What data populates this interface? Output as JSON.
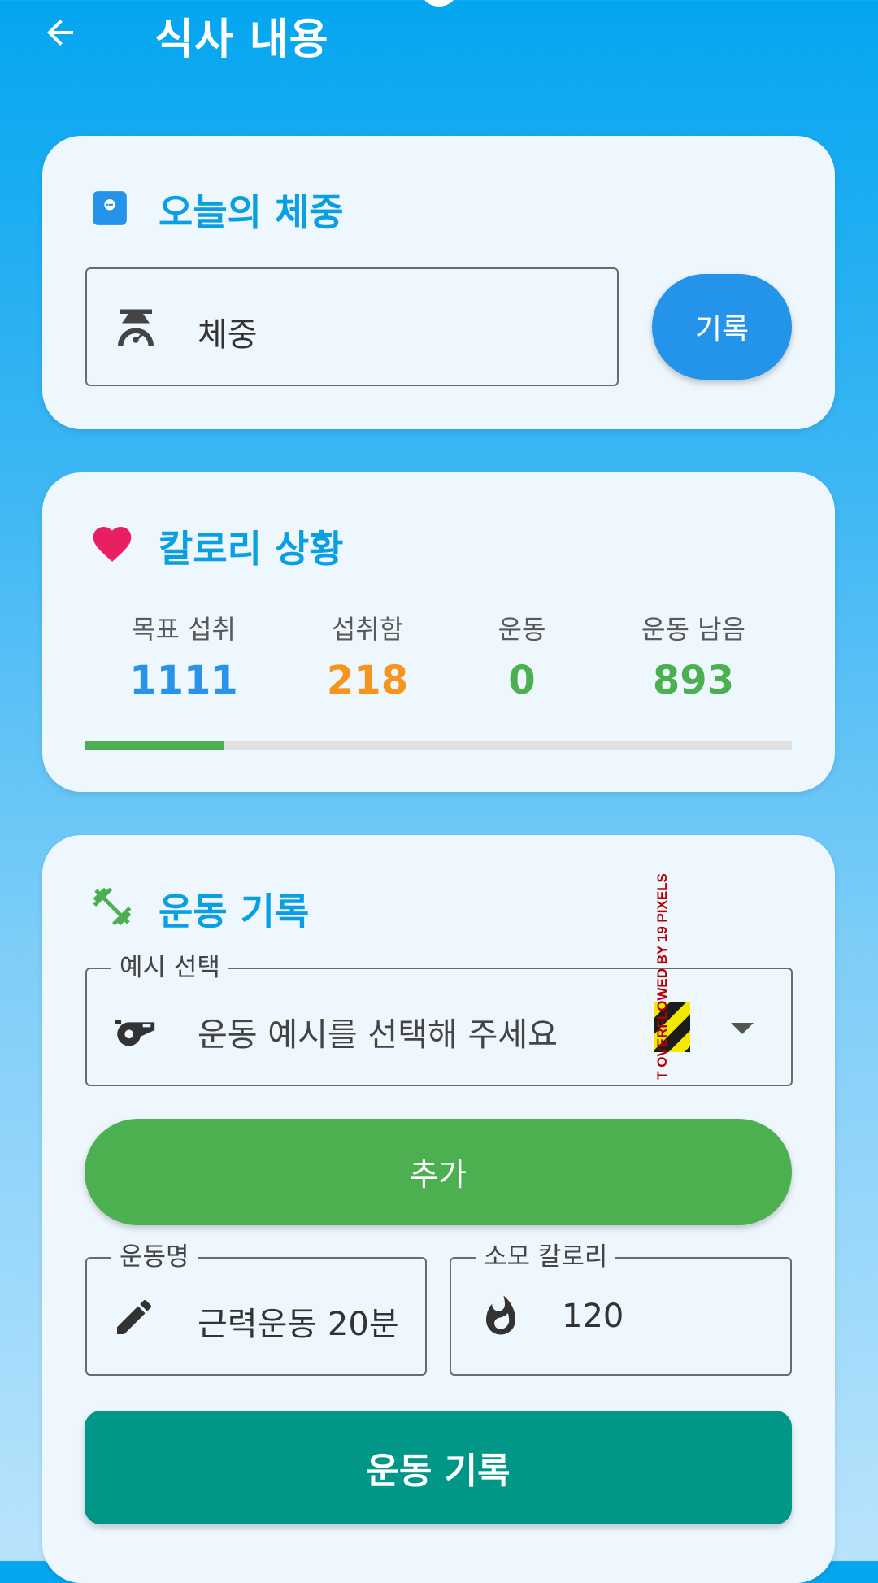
{
  "header": {
    "title": "식사 내용",
    "back_icon": "arrow-left-icon"
  },
  "weight_card": {
    "title": "오늘의 체중",
    "title_icon": "chat-bubble-icon",
    "input_placeholder": "체중",
    "input_icon": "scale-icon",
    "record_button": "기록"
  },
  "calorie_card": {
    "title": "칼로리 상황",
    "title_icon": "heart-icon",
    "stats": [
      {
        "label": "목표 섭취",
        "value": "1111",
        "color": "#2893e8"
      },
      {
        "label": "섭취함",
        "value": "218",
        "color": "#f7941d"
      },
      {
        "label": "운동",
        "value": "0",
        "color": "#4caf50"
      },
      {
        "label": "운동 남음",
        "value": "893",
        "color": "#4caf50"
      }
    ],
    "progress_fraction": 0.196
  },
  "exercise_card": {
    "title": "운동 기록",
    "title_icon": "dumbbell-icon",
    "example_select": {
      "legend": "예시 선택",
      "placeholder": "운동 예시를 선택해 주세요",
      "icon": "whistle-icon"
    },
    "overflow_warning": "T OVERFLOWED BY 19 PIXELS",
    "add_button": "추가",
    "name_field": {
      "legend": "운동명",
      "value": "근력운동 20분",
      "icon": "pencil-icon"
    },
    "calorie_field": {
      "legend": "소모 칼로리",
      "value": "120",
      "icon": "flame-icon"
    },
    "submit_button": "운동 기록"
  },
  "colors": {
    "accent_blue": "#0a9fe3",
    "button_blue": "#2493ea",
    "add_green": "#4caf50",
    "submit_teal": "#009688",
    "heart_pink": "#e91e63"
  }
}
